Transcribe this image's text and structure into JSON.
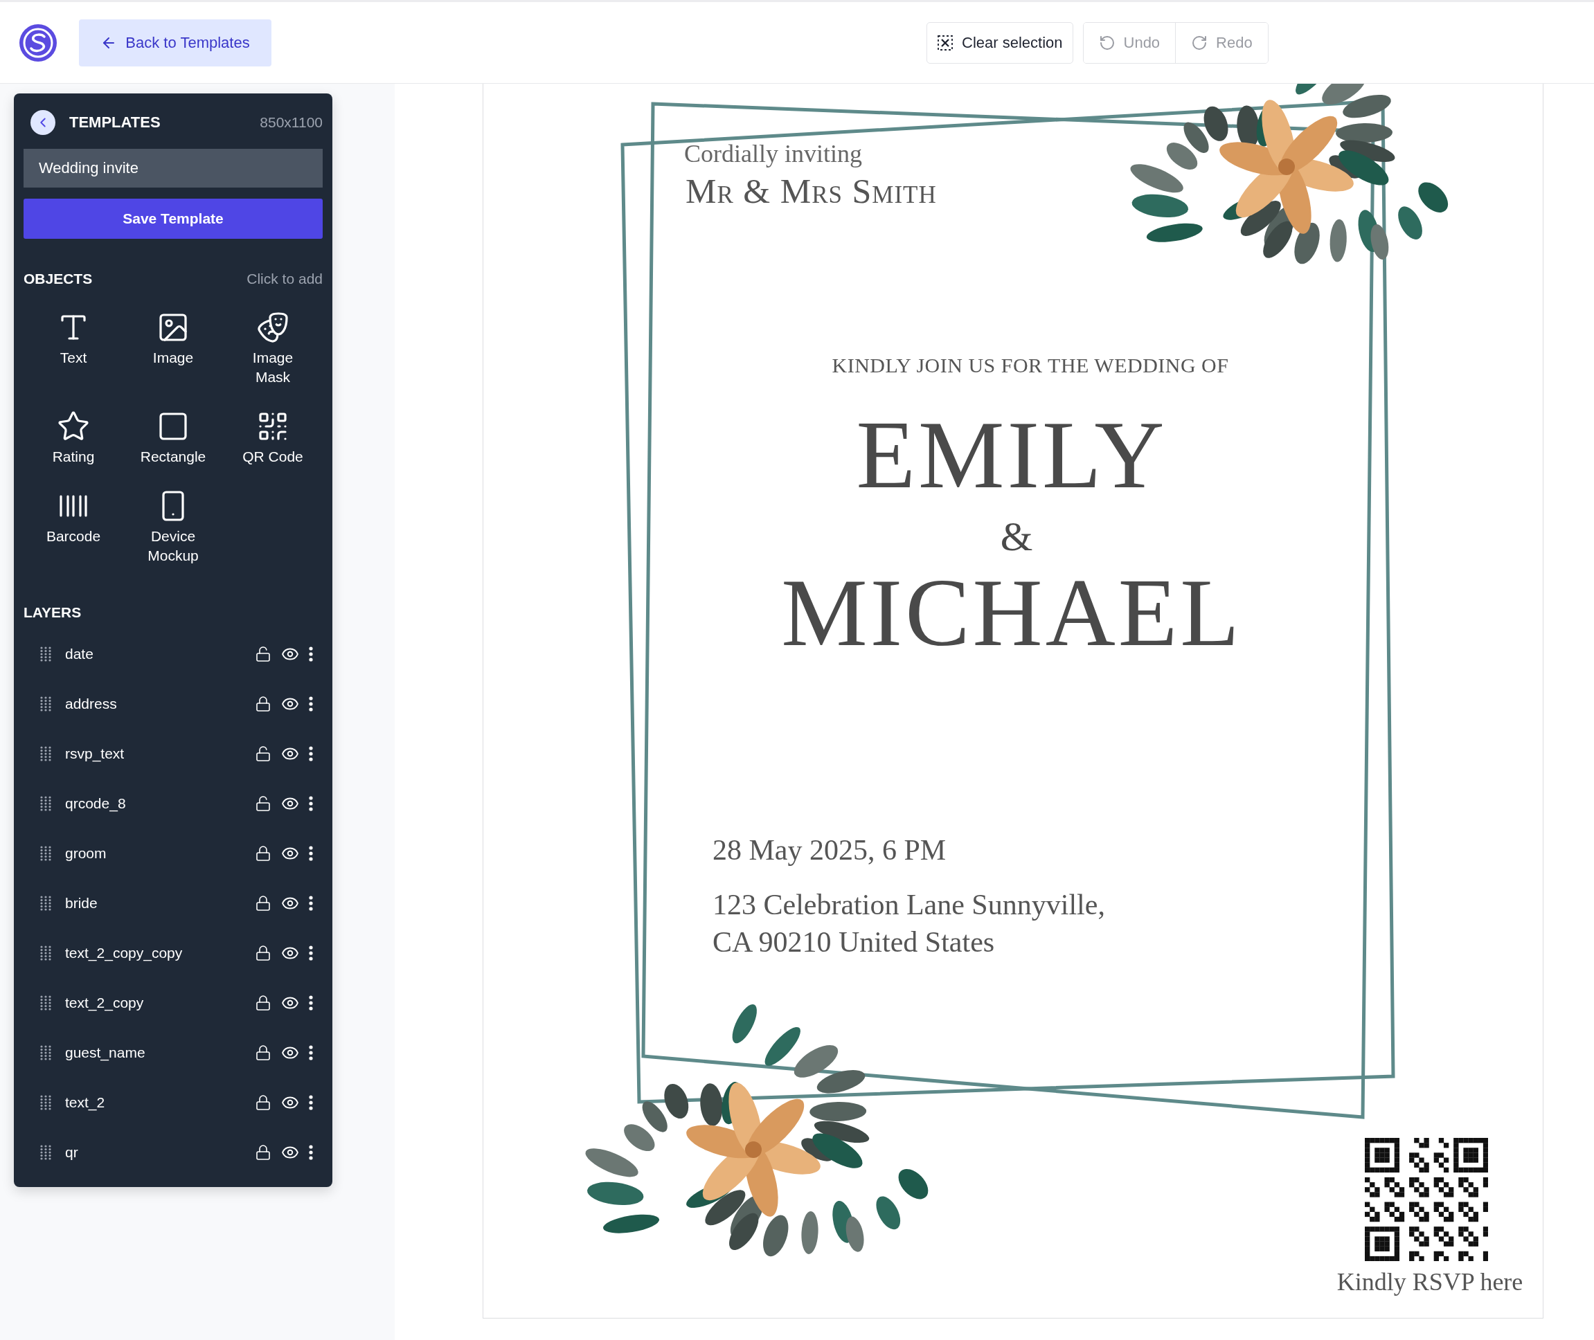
{
  "topbar": {
    "back_button": "Back to Templates",
    "buttons": [
      {
        "kind": "clear",
        "label": "Clear selection",
        "disabled": false
      },
      {
        "kind": "undo",
        "label": "Undo",
        "disabled": true
      },
      {
        "kind": "redo",
        "label": "Redo",
        "disabled": true
      }
    ]
  },
  "sidebar": {
    "title": "TEMPLATES",
    "size": "850x1100",
    "template_name": "Wedding invite",
    "save_button": "Save Template",
    "objects": {
      "title": "OBJECTS",
      "hint": "Click to add",
      "items": [
        {
          "kind": "text",
          "label": "Text"
        },
        {
          "kind": "image",
          "label": "Image"
        },
        {
          "kind": "mask",
          "label": "Image Mask"
        },
        {
          "kind": "rating",
          "label": "Rating"
        },
        {
          "kind": "rectangle",
          "label": "Rectangle"
        },
        {
          "kind": "qr",
          "label": "QR Code"
        },
        {
          "kind": "barcode",
          "label": "Barcode"
        },
        {
          "kind": "device",
          "label": "Device Mockup"
        }
      ]
    },
    "layers": {
      "title": "LAYERS",
      "items": [
        {
          "name": "date",
          "locked": false,
          "visible": true
        },
        {
          "name": "address",
          "locked": true,
          "visible": true
        },
        {
          "name": "rsvp_text",
          "locked": false,
          "visible": true
        },
        {
          "name": "qrcode_8",
          "locked": false,
          "visible": true
        },
        {
          "name": "groom",
          "locked": true,
          "visible": true
        },
        {
          "name": "bride",
          "locked": true,
          "visible": true
        },
        {
          "name": "text_2_copy_copy",
          "locked": true,
          "visible": true
        },
        {
          "name": "text_2_copy",
          "locked": true,
          "visible": true
        },
        {
          "name": "guest_name",
          "locked": true,
          "visible": true
        },
        {
          "name": "text_2",
          "locked": true,
          "visible": true
        },
        {
          "name": "qr",
          "locked": true,
          "visible": true
        }
      ]
    }
  },
  "invitation": {
    "greeting": "Cordially inviting",
    "guest": "Mr & Mrs Smith",
    "heading": "KINDLY JOIN US FOR THE WEDDING OF",
    "bride": "EMILY",
    "ampersand": "&",
    "groom": "MICHAEL",
    "date": "28 May 2025, 6 PM",
    "address": "123 Celebration Lane Sunnyville, CA 90210 United States",
    "rsvp": "Kindly RSVP here"
  }
}
